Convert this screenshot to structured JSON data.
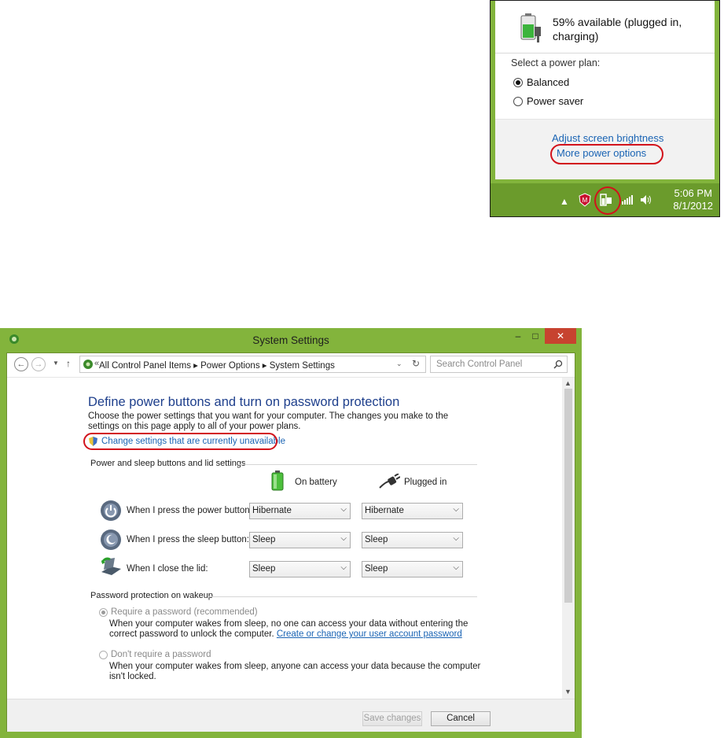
{
  "flyout": {
    "status": "59% available (plugged in, charging)",
    "plans_label": "Select a power plan:",
    "plans": [
      {
        "label": "Balanced",
        "selected": true
      },
      {
        "label": "Power saver",
        "selected": false
      }
    ],
    "brightness_link": "Adjust screen brightness",
    "more_link": "More power options",
    "time": "5:06 PM",
    "date": "8/1/2012",
    "accent": "#82b43c"
  },
  "window": {
    "title": "System Settings",
    "nav": {
      "breadcrumbs": [
        "All Control Panel Items",
        "Power Options",
        "System Settings"
      ],
      "search_placeholder": "Search Control Panel"
    },
    "heading": "Define power buttons and turn on password protection",
    "description": "Choose the power settings that you want for your computer. The changes you make to the settings on this page apply to all of your power plans.",
    "change_link": "Change settings that are currently unavailable",
    "section1": "Power and sleep buttons and lid settings",
    "col_battery": "On battery",
    "col_plugged": "Plugged in",
    "rows": [
      {
        "label": "When I press the power button:",
        "battery": "Hibernate",
        "plugged": "Hibernate"
      },
      {
        "label": "When I press the sleep button:",
        "battery": "Sleep",
        "plugged": "Sleep"
      },
      {
        "label": "When I close the lid:",
        "battery": "Sleep",
        "plugged": "Sleep"
      }
    ],
    "section2": "Password protection on wakeup",
    "require": {
      "label": "Require a password (recommended)",
      "desc": "When your computer wakes from sleep, no one can access your data without entering the correct password to unlock the computer.",
      "link": "Create or change your user account password"
    },
    "norequire": {
      "label": "Don't require a password",
      "desc": "When your computer wakes from sleep, anyone can access your data because the computer isn't locked."
    },
    "save": "Save changes",
    "cancel": "Cancel",
    "accent": "#83b43c",
    "close_color": "#c7432f"
  }
}
